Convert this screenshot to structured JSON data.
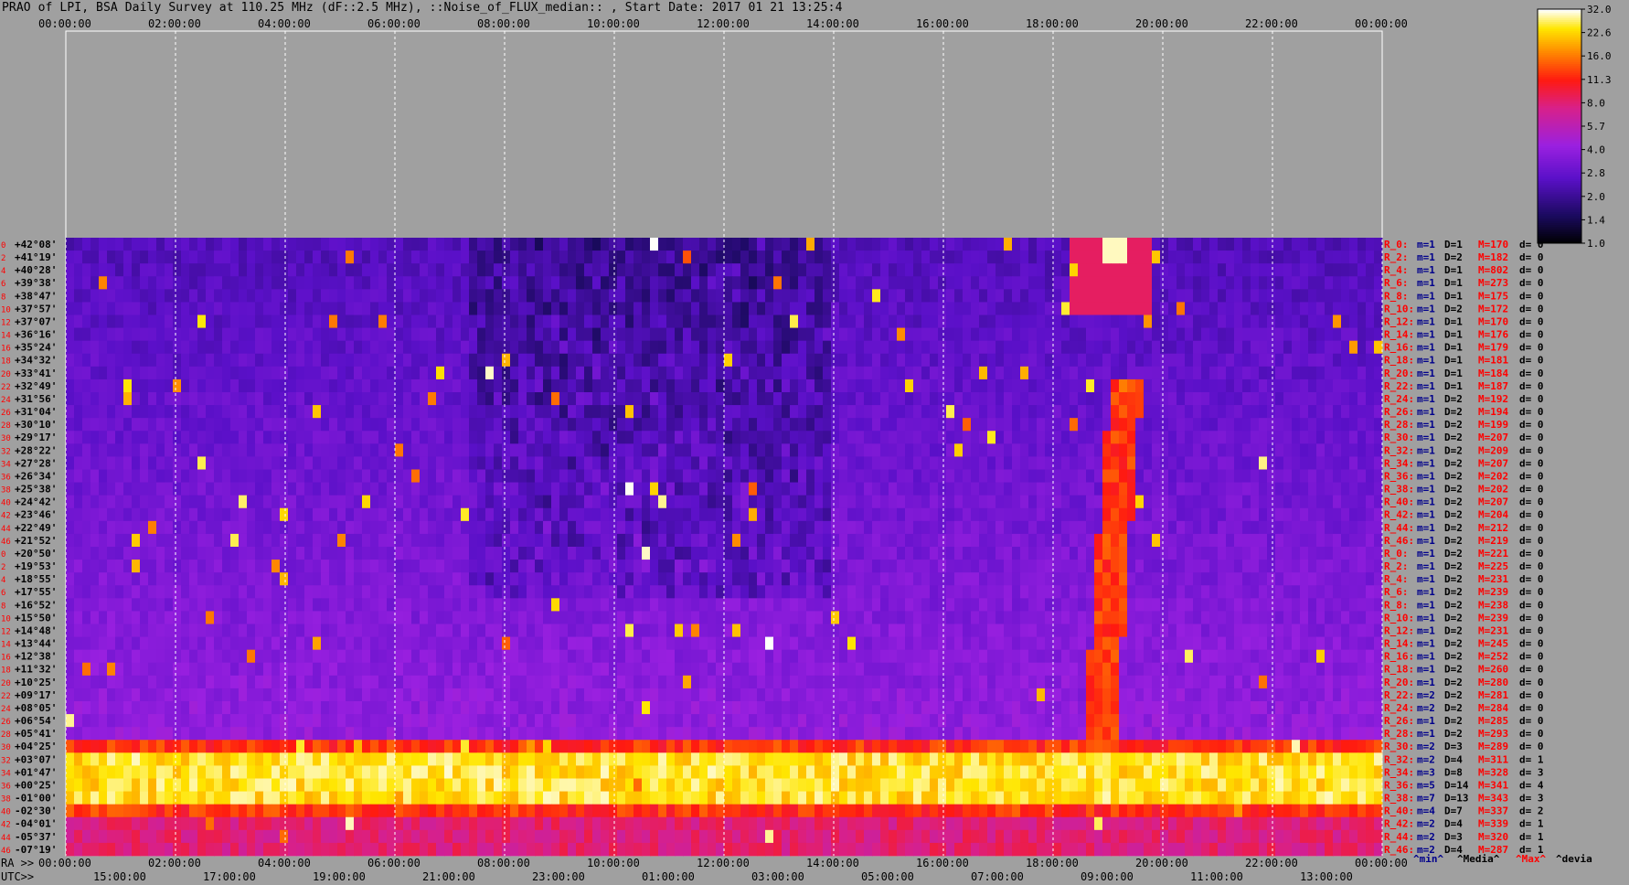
{
  "title": "PRAO of LPI, BSA Daily Survey at 110.25 MHz (dF::2.5 MHz), ::Noise_of_FLUX_median:: , Start Date: 2017 01 21 13:25:4",
  "colors": {
    "background": "#a0a0a0",
    "left_labels": "#ff0000",
    "right_labels_prefix": "#ff0000",
    "footer_min": "#00008b",
    "footer_max": "#ff0000"
  },
  "chart_data": {
    "type": "heatmap",
    "top_axis_ticks": [
      "00:00:00",
      "02:00:00",
      "04:00:00",
      "06:00:00",
      "08:00:00",
      "10:00:00",
      "12:00:00",
      "14:00:00",
      "16:00:00",
      "18:00:00",
      "20:00:00",
      "22:00:00",
      "00:00:00"
    ],
    "bottom_ra_prefix": "RA >>",
    "bottom_ra_ticks": [
      "00:00:00",
      "02:00:00",
      "04:00:00",
      "06:00:00",
      "08:00:00",
      "10:00:00",
      "12:00:00",
      "14:00:00",
      "16:00:00",
      "18:00:00",
      "20:00:00",
      "22:00:00",
      "00:00:00"
    ],
    "bottom_utc_prefix": "UTC>>",
    "bottom_utc_ticks": [
      "15:00:00",
      "17:00:00",
      "19:00:00",
      "21:00:00",
      "23:00:00",
      "01:00:00",
      "03:00:00",
      "05:00:00",
      "07:00:00",
      "09:00:00",
      "11:00:00",
      "13:00:00"
    ],
    "colorbar_ticks": [
      "32.0",
      "22.6",
      "16.0",
      "11.3",
      "8.0",
      "5.7",
      "4.0",
      "2.8",
      "2.0",
      "1.4",
      "1.0"
    ],
    "declinations": [
      "+42°08'",
      "+41°19'",
      "+40°28'",
      "+39°38'",
      "+38°47'",
      "+37°57'",
      "+37°07'",
      "+36°16'",
      "+35°24'",
      "+34°32'",
      "+33°41'",
      "+32°49'",
      "+31°56'",
      "+31°04'",
      "+30°10'",
      "+29°17'",
      "+28°22'",
      "+27°28'",
      "+26°34'",
      "+25°38'",
      "+24°42'",
      "+23°46'",
      "+22°49'",
      "+21°52'",
      "+20°50'",
      "+19°53'",
      "+18°55'",
      "+17°55'",
      "+16°52'",
      "+15°50'",
      "+14°48'",
      "+13°44'",
      "+12°38'",
      "+11°32'",
      "+10°25'",
      "+09°17'",
      "+08°05'",
      "+06°54'",
      "+05°41'",
      "+04°25'",
      "+03°07'",
      "+01°47'",
      "+00°25'",
      "-01°00'",
      "-02°30'",
      "-04°01'",
      "-05°37'",
      "-07°19'"
    ],
    "row_numbers": [
      "0",
      "2",
      "4",
      "6",
      "8",
      "10",
      "12",
      "14",
      "16",
      "18",
      "20",
      "22",
      "24",
      "26",
      "28",
      "30",
      "32",
      "34",
      "36",
      "38",
      "40",
      "42",
      "44",
      "46",
      "0",
      "2",
      "4",
      "6",
      "8",
      "10",
      "12",
      "14",
      "16",
      "18",
      "20",
      "22",
      "24",
      "26",
      "28",
      "30",
      "32",
      "34",
      "36",
      "38",
      "40",
      "42",
      "44",
      "46"
    ],
    "right_stats": [
      {
        "r": "R_0:",
        "m": "m=1",
        "D": "D=1",
        "M": "M=170",
        "d": "d= 0"
      },
      {
        "r": "R_2:",
        "m": "m=1",
        "D": "D=2",
        "M": "M=182",
        "d": "d= 0"
      },
      {
        "r": "R_4:",
        "m": "m=1",
        "D": "D=1",
        "M": "M=802",
        "d": "d= 0"
      },
      {
        "r": "R_6:",
        "m": "m=1",
        "D": "D=1",
        "M": "M=273",
        "d": "d= 0"
      },
      {
        "r": "R_8:",
        "m": "m=1",
        "D": "D=1",
        "M": "M=175",
        "d": "d= 0"
      },
      {
        "r": "R_10:",
        "m": "m=1",
        "D": "D=2",
        "M": "M=172",
        "d": "d= 0"
      },
      {
        "r": "R_12:",
        "m": "m=1",
        "D": "D=1",
        "M": "M=170",
        "d": "d= 0"
      },
      {
        "r": "R_14:",
        "m": "m=1",
        "D": "D=1",
        "M": "M=176",
        "d": "d= 0"
      },
      {
        "r": "R_16:",
        "m": "m=1",
        "D": "D=1",
        "M": "M=179",
        "d": "d= 0"
      },
      {
        "r": "R_18:",
        "m": "m=1",
        "D": "D=1",
        "M": "M=181",
        "d": "d= 0"
      },
      {
        "r": "R_20:",
        "m": "m=1",
        "D": "D=1",
        "M": "M=184",
        "d": "d= 0"
      },
      {
        "r": "R_22:",
        "m": "m=1",
        "D": "D=1",
        "M": "M=187",
        "d": "d= 0"
      },
      {
        "r": "R_24:",
        "m": "m=1",
        "D": "D=2",
        "M": "M=192",
        "d": "d= 0"
      },
      {
        "r": "R_26:",
        "m": "m=1",
        "D": "D=2",
        "M": "M=194",
        "d": "d= 0"
      },
      {
        "r": "R_28:",
        "m": "m=1",
        "D": "D=2",
        "M": "M=199",
        "d": "d= 0"
      },
      {
        "r": "R_30:",
        "m": "m=1",
        "D": "D=2",
        "M": "M=207",
        "d": "d= 0"
      },
      {
        "r": "R_32:",
        "m": "m=1",
        "D": "D=2",
        "M": "M=209",
        "d": "d= 0"
      },
      {
        "r": "R_34:",
        "m": "m=1",
        "D": "D=2",
        "M": "M=207",
        "d": "d= 0"
      },
      {
        "r": "R_36:",
        "m": "m=1",
        "D": "D=2",
        "M": "M=202",
        "d": "d= 0"
      },
      {
        "r": "R_38:",
        "m": "m=1",
        "D": "D=2",
        "M": "M=202",
        "d": "d= 0"
      },
      {
        "r": "R_40:",
        "m": "m=1",
        "D": "D=2",
        "M": "M=207",
        "d": "d= 0"
      },
      {
        "r": "R_42:",
        "m": "m=1",
        "D": "D=2",
        "M": "M=204",
        "d": "d= 0"
      },
      {
        "r": "R_44:",
        "m": "m=1",
        "D": "D=2",
        "M": "M=212",
        "d": "d= 0"
      },
      {
        "r": "R_46:",
        "m": "m=1",
        "D": "D=2",
        "M": "M=219",
        "d": "d= 0"
      },
      {
        "r": "R_0:",
        "m": "m=1",
        "D": "D=2",
        "M": "M=221",
        "d": "d= 0"
      },
      {
        "r": "R_2:",
        "m": "m=1",
        "D": "D=2",
        "M": "M=225",
        "d": "d= 0"
      },
      {
        "r": "R_4:",
        "m": "m=1",
        "D": "D=2",
        "M": "M=231",
        "d": "d= 0"
      },
      {
        "r": "R_6:",
        "m": "m=1",
        "D": "D=2",
        "M": "M=239",
        "d": "d= 0"
      },
      {
        "r": "R_8:",
        "m": "m=1",
        "D": "D=2",
        "M": "M=238",
        "d": "d= 0"
      },
      {
        "r": "R_10:",
        "m": "m=1",
        "D": "D=2",
        "M": "M=239",
        "d": "d= 0"
      },
      {
        "r": "R_12:",
        "m": "m=1",
        "D": "D=2",
        "M": "M=231",
        "d": "d= 0"
      },
      {
        "r": "R_14:",
        "m": "m=1",
        "D": "D=2",
        "M": "M=245",
        "d": "d= 0"
      },
      {
        "r": "R_16:",
        "m": "m=1",
        "D": "D=2",
        "M": "M=252",
        "d": "d= 0"
      },
      {
        "r": "R_18:",
        "m": "m=1",
        "D": "D=2",
        "M": "M=260",
        "d": "d= 0"
      },
      {
        "r": "R_20:",
        "m": "m=1",
        "D": "D=2",
        "M": "M=280",
        "d": "d= 0"
      },
      {
        "r": "R_22:",
        "m": "m=2",
        "D": "D=2",
        "M": "M=281",
        "d": "d= 0"
      },
      {
        "r": "R_24:",
        "m": "m=2",
        "D": "D=2",
        "M": "M=284",
        "d": "d= 0"
      },
      {
        "r": "R_26:",
        "m": "m=1",
        "D": "D=2",
        "M": "M=285",
        "d": "d= 0"
      },
      {
        "r": "R_28:",
        "m": "m=1",
        "D": "D=2",
        "M": "M=293",
        "d": "d= 0"
      },
      {
        "r": "R_30:",
        "m": "m=2",
        "D": "D=3",
        "M": "M=289",
        "d": "d= 0"
      },
      {
        "r": "R_32:",
        "m": "m=2",
        "D": "D=4",
        "M": "M=311",
        "d": "d= 1"
      },
      {
        "r": "R_34:",
        "m": "m=3",
        "D": "D=8",
        "M": "M=328",
        "d": "d= 3"
      },
      {
        "r": "R_36:",
        "m": "m=5",
        "D": "D=14",
        "M": "M=341",
        "d": "d= 4"
      },
      {
        "r": "R_38:",
        "m": "m=7",
        "D": "D=13",
        "M": "M=343",
        "d": "d= 3"
      },
      {
        "r": "R_40:",
        "m": "m=4",
        "D": "D=7",
        "M": "M=337",
        "d": "d= 2"
      },
      {
        "r": "R_42:",
        "m": "m=2",
        "D": "D=4",
        "M": "M=339",
        "d": "d= 1"
      },
      {
        "r": "R_44:",
        "m": "m=2",
        "D": "D=3",
        "M": "M=320",
        "d": "d= 1"
      },
      {
        "r": "R_46:",
        "m": "m=2",
        "D": "D=4",
        "M": "M=287",
        "d": "d= 1"
      }
    ],
    "footer_labels": {
      "min": "^min^",
      "median": "^Media^",
      "max": "^Max^",
      "dev": "^devia"
    },
    "color_range": [
      1.0,
      32.0
    ]
  }
}
